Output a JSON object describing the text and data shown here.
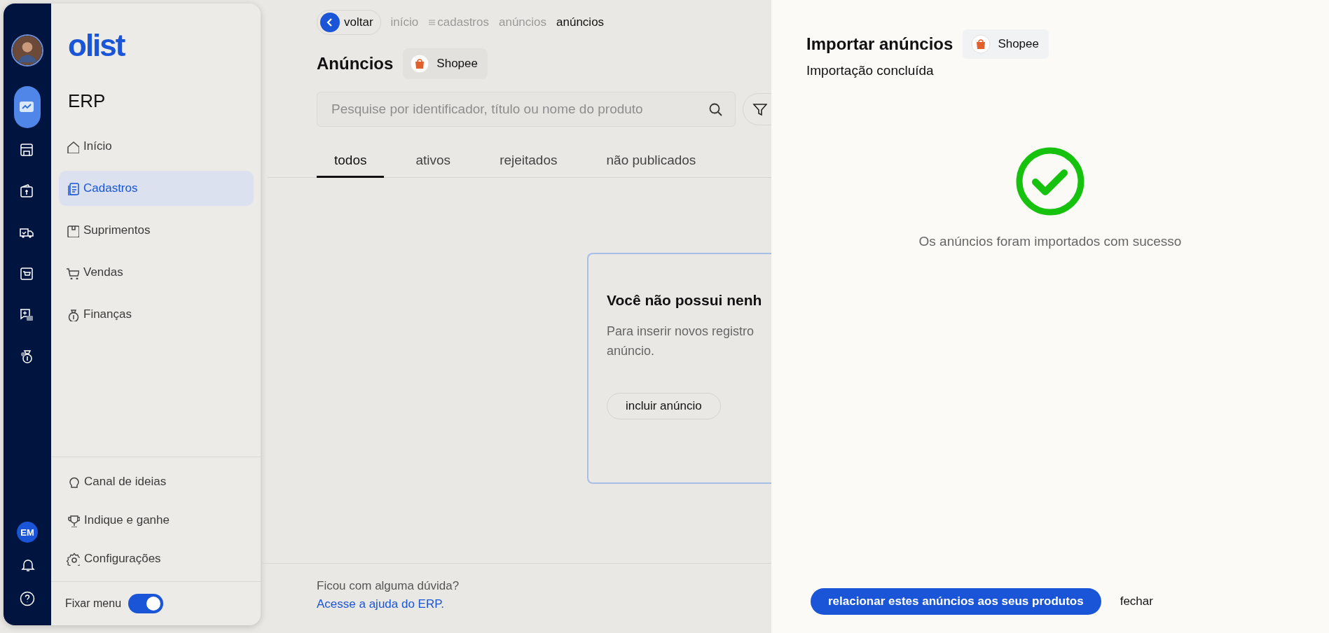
{
  "rail": {
    "apps": [
      {
        "selected": true
      },
      {
        "selected": false
      },
      {
        "selected": false
      },
      {
        "selected": false
      },
      {
        "selected": false
      },
      {
        "selected": false
      },
      {
        "selected": false
      }
    ],
    "user_initials": "EM"
  },
  "sidebar": {
    "logo": "olist",
    "section": "ERP",
    "items": [
      {
        "label": "Início",
        "selected": false
      },
      {
        "label": "Cadastros",
        "selected": true
      },
      {
        "label": "Suprimentos",
        "selected": false
      },
      {
        "label": "Vendas",
        "selected": false
      },
      {
        "label": "Finanças",
        "selected": false
      }
    ],
    "footer_items": [
      {
        "label": "Canal de ideias"
      },
      {
        "label": "Indique e ganhe"
      },
      {
        "label": "Configurações"
      }
    ],
    "pin": {
      "label": "Fixar menu",
      "on": true
    }
  },
  "breadcrumb": {
    "back": "voltar",
    "items": [
      {
        "label": "início",
        "current": false,
        "menu_icon": false
      },
      {
        "label": "cadastros",
        "current": false,
        "menu_icon": true
      },
      {
        "label": "anúncios",
        "current": false,
        "menu_icon": false
      },
      {
        "label": "anúncios",
        "current": true,
        "menu_icon": false
      }
    ]
  },
  "page": {
    "title": "Anúncios",
    "channel": "Shopee"
  },
  "search": {
    "placeholder": "Pesquise por identificador, título ou nome do produto"
  },
  "tabs": [
    {
      "label": "todos",
      "selected": true
    },
    {
      "label": "ativos",
      "selected": false
    },
    {
      "label": "rejeitados",
      "selected": false
    },
    {
      "label": "não publicados",
      "selected": false
    }
  ],
  "empty_card": {
    "title": "Você não possui nenh",
    "text": "Para inserir novos registro",
    "text_2": "anúncio.",
    "button": "incluir anúncio"
  },
  "help": {
    "question": "Ficou com alguma dúvida?",
    "link": "Acesse a ajuda do ERP."
  },
  "panel": {
    "title": "Importar anúncios",
    "channel": "Shopee",
    "subtitle": "Importação concluída",
    "message": "Os anúncios foram importados com sucesso",
    "primary_button": "relacionar estes anúncios aos seus produtos",
    "secondary_button": "fechar"
  }
}
